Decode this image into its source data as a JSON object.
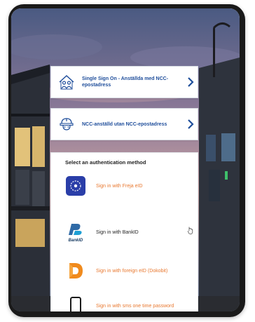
{
  "sso": {
    "ncc_employee_label": "Single Sign On - Anställda med NCC-epostadress",
    "ncc_no_email_label": "NCC-anställd utan NCC-epostadress"
  },
  "auth": {
    "heading": "Select an authentication method",
    "methods": [
      {
        "label": "Sign in with Freja eID",
        "icon": "freja-eid-icon",
        "color": "#e8772e"
      },
      {
        "label": "Sign in with BankID",
        "icon": "bankid-icon",
        "color": "#222222"
      },
      {
        "label": "Sign in with foreign eID (Dokobit)",
        "icon": "dokobit-icon",
        "color": "#e8772e"
      },
      {
        "label": "Sign in with sms one time password",
        "icon": "mobile-phone-icon",
        "color": "#e8772e"
      }
    ]
  },
  "logos": {
    "bankid_text": "BankID"
  },
  "colors": {
    "accent_blue": "#1f4e9b",
    "accent_orange": "#e8772e"
  }
}
